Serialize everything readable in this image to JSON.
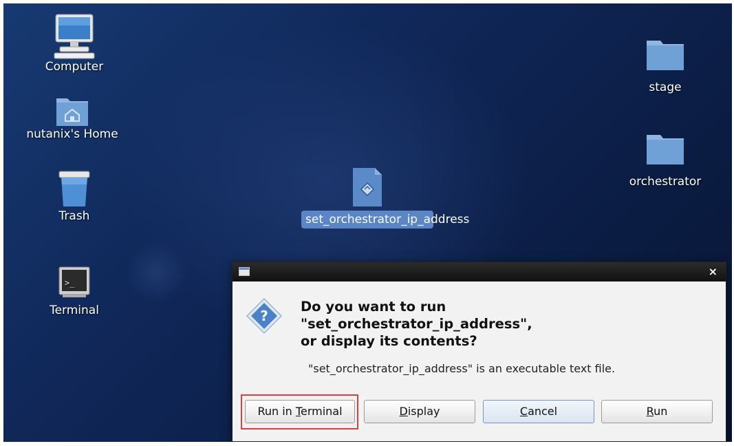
{
  "desktop": {
    "icons": [
      {
        "label": "Computer"
      },
      {
        "label": "nutanix's Home"
      },
      {
        "label": "Trash"
      },
      {
        "label": "Terminal"
      },
      {
        "label": "stage"
      },
      {
        "label": "orchestrator"
      },
      {
        "label": "set_orchestrator_ip_address",
        "selected": true
      }
    ]
  },
  "dialog": {
    "close_glyph": "×",
    "heading": "Do you want to run\n\"set_orchestrator_ip_address\",\nor display its contents?",
    "detail": "\"set_orchestrator_ip_address\" is an executable text file.",
    "buttons": [
      {
        "label": "Run in Terminal",
        "mnemonic": "T"
      },
      {
        "label": "Display",
        "mnemonic": "D"
      },
      {
        "label": "Cancel",
        "mnemonic": "C",
        "focused": true
      },
      {
        "label": "Run",
        "mnemonic": "R"
      }
    ]
  },
  "colors": {
    "desktop_bg": "#10285a",
    "selection": "#5a85c7",
    "highlight_box": "#d9423c"
  },
  "icon_names": [
    "computer-icon",
    "home-folder-icon",
    "trash-icon",
    "terminal-icon",
    "folder-icon",
    "script-file-icon",
    "question-icon",
    "window-icon",
    "close-icon"
  ]
}
